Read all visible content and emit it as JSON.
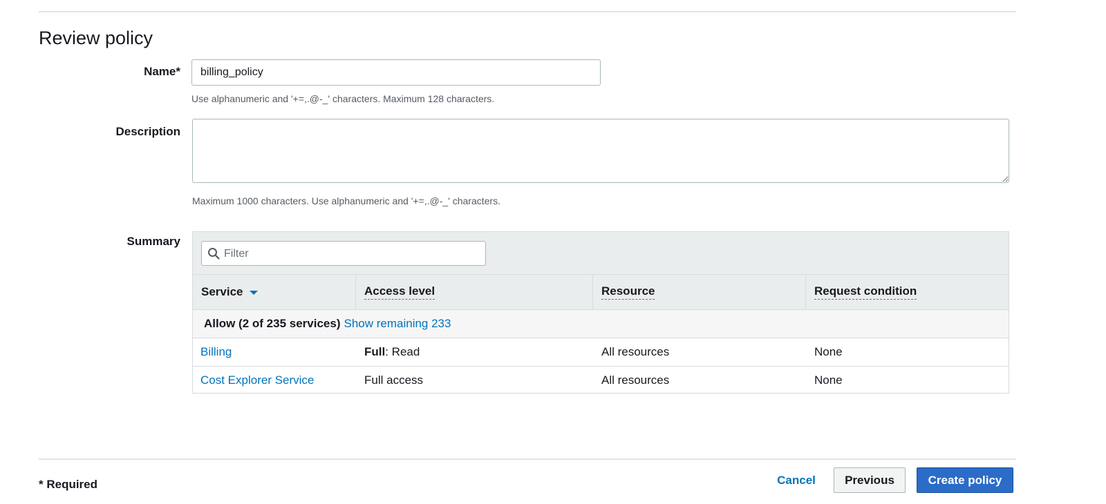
{
  "page": {
    "title": "Review policy"
  },
  "name_field": {
    "label": "Name*",
    "value": "billing_policy",
    "hint": "Use alphanumeric and '+=,.@-_' characters. Maximum 128 characters."
  },
  "description_field": {
    "label": "Description",
    "value": "",
    "hint": "Maximum 1000 characters. Use alphanumeric and '+=,.@-_' characters."
  },
  "summary": {
    "label": "Summary",
    "filter_placeholder": "Filter",
    "columns": [
      "Service",
      "Access level",
      "Resource",
      "Request condition"
    ],
    "group": {
      "title": "Allow (2 of 235 services)",
      "link": "Show remaining 233"
    },
    "rows": [
      {
        "service": "Billing",
        "access_bold": "Full",
        "access_rest": ": Read",
        "resource": "All resources",
        "condition": "None"
      },
      {
        "service": "Cost Explorer Service",
        "access_bold": "",
        "access_rest": "Full access",
        "resource": "All resources",
        "condition": "None"
      }
    ]
  },
  "footer": {
    "required_note": "* Required",
    "cancel_label": "Cancel",
    "previous_label": "Previous",
    "create_label": "Create policy"
  },
  "colors": {
    "link": "#0073bb",
    "primary_button": "#2b6cc8",
    "header_bg": "#eaeded"
  }
}
